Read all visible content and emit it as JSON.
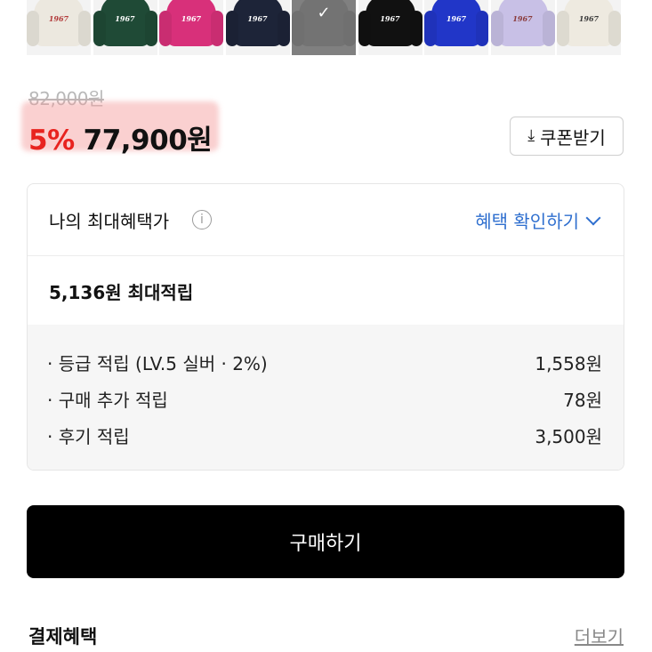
{
  "swatches": [
    {
      "color": "#ece8df",
      "logo_color": "#b23a3a",
      "logo": "1967"
    },
    {
      "color": "#1f4a36",
      "logo_color": "#ffffff",
      "logo": "1967"
    },
    {
      "color": "#d8307a",
      "logo_color": "#ffffff",
      "logo": "1967"
    },
    {
      "color": "#1d2438",
      "logo_color": "#ffffff",
      "logo": "1967"
    },
    {
      "color": "#6e6e6e",
      "logo_color": "#ffffff",
      "logo": "",
      "selected": true
    },
    {
      "color": "#111111",
      "logo_color": "#ffffff",
      "logo": "1967"
    },
    {
      "color": "#2136c8",
      "logo_color": "#ffffff",
      "logo": "1967"
    },
    {
      "color": "#c8c0e6",
      "logo_color": "#8a3a3a",
      "logo": "1967"
    },
    {
      "color": "#eeeae0",
      "logo_color": "#3a3a3a",
      "logo": "1967"
    }
  ],
  "price": {
    "original": "82,000원",
    "discount_rate": "5%",
    "sale": "77,900원",
    "accent_color": "#e8231f"
  },
  "coupon": {
    "label": "쿠폰받기",
    "icon": "download-icon"
  },
  "benefit": {
    "title": "나의 최대혜택가",
    "info_icon": "info-icon",
    "link_label": "혜택 확인하기",
    "link_color": "#2f6fcf",
    "total": "5,136원 최대적립",
    "details": [
      {
        "label": "· 등급 적립 (LV.5 실버 · 2%)",
        "amount": "1,558원"
      },
      {
        "label": "· 구매 추가 적립",
        "amount": "78원"
      },
      {
        "label": "· 후기 적립",
        "amount": "3,500원"
      }
    ]
  },
  "buy": {
    "label": "구매하기"
  },
  "payment": {
    "title": "결제혜택",
    "more_label": "더보기"
  }
}
